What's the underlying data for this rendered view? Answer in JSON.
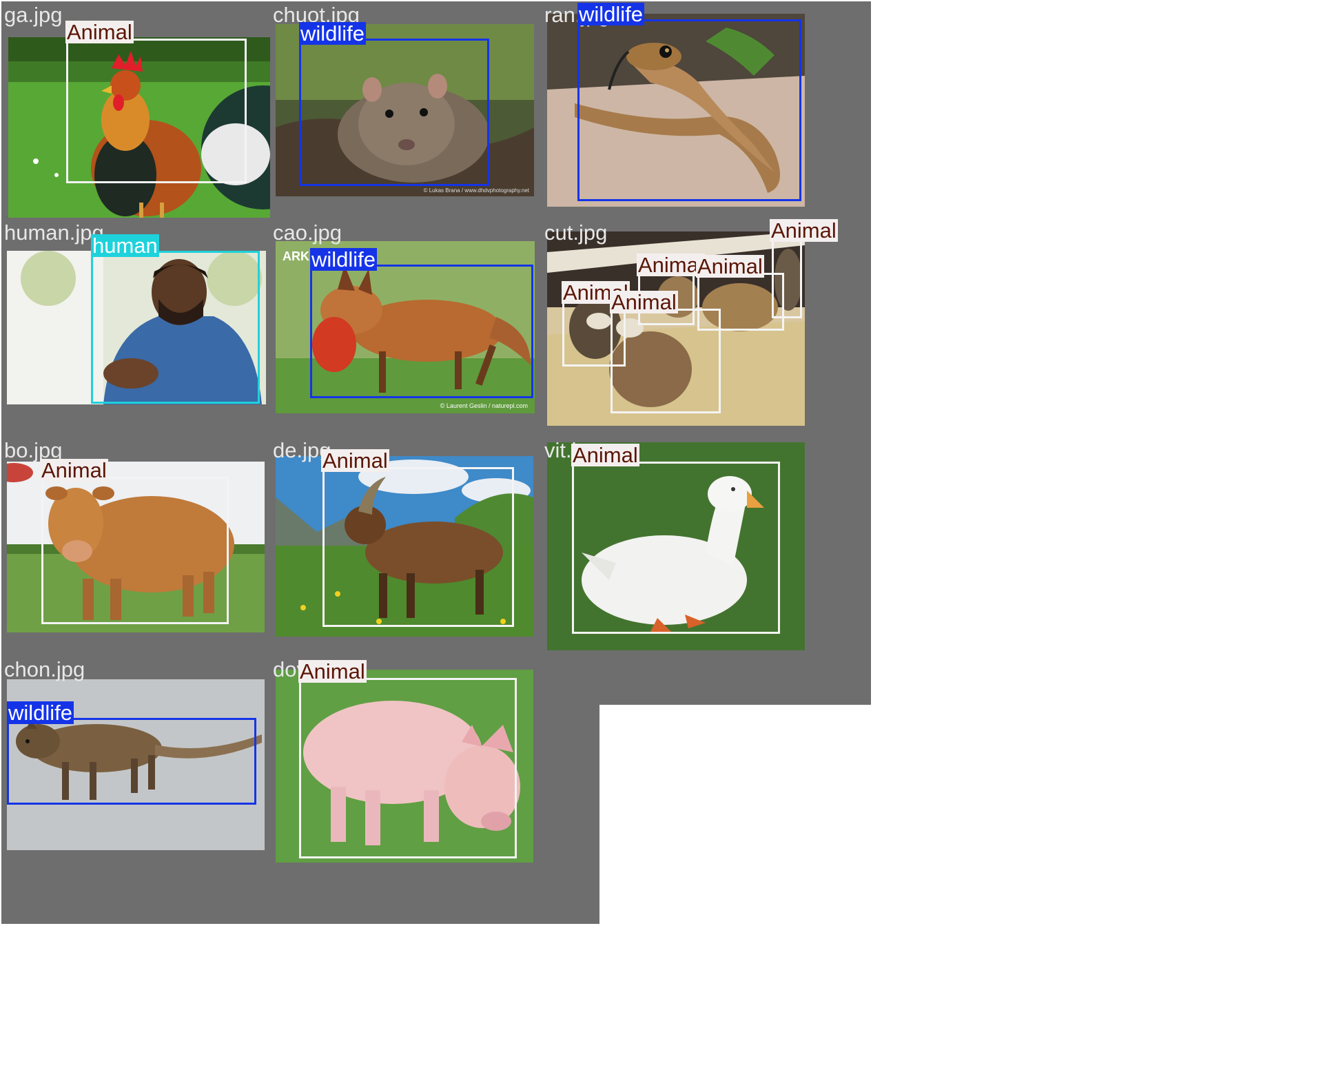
{
  "grid": {
    "cells": [
      {
        "filename": "ga.jpg",
        "boxes": [
          {
            "label": "Animal"
          }
        ]
      },
      {
        "filename": "chuot.jpg",
        "boxes": [
          {
            "label": "wildlife"
          }
        ]
      },
      {
        "filename": "ran.jpg",
        "boxes": [
          {
            "label": "wildlife"
          }
        ]
      },
      {
        "filename": "human.jpg",
        "boxes": [
          {
            "label": "human"
          }
        ]
      },
      {
        "filename": "cao.jpg",
        "boxes": [
          {
            "label": "wildlife"
          }
        ]
      },
      {
        "filename": "cut.jpg",
        "boxes": [
          {
            "label": "Animal"
          },
          {
            "label": "Animal"
          },
          {
            "label": "Animal"
          },
          {
            "label": "Animal"
          },
          {
            "label": "Animal"
          }
        ]
      },
      {
        "filename": "bo.jpg",
        "boxes": [
          {
            "label": "Animal"
          }
        ]
      },
      {
        "filename": "de.jpg",
        "boxes": [
          {
            "label": "Animal"
          }
        ]
      },
      {
        "filename": "vit.jpg",
        "boxes": [
          {
            "label": "Animal"
          }
        ]
      },
      {
        "filename": "chon.jpg",
        "boxes": [
          {
            "label": "wildlife"
          }
        ]
      },
      {
        "filename": "dov.jpg",
        "boxes": [
          {
            "label": "Animal"
          }
        ]
      }
    ]
  },
  "photo_text": {
    "chuot_credit": "© Lukas Brana / www.dhdvphotography.net",
    "cao_logo": "ARK",
    "cao_credit": "© Laurent Geslin / naturepl.com"
  },
  "colors": {
    "cell_background": "#6e6e6e",
    "animal_box": "#f4f4f4",
    "wildlife_box": "#1534e8",
    "human_box": "#1ed2dc"
  }
}
